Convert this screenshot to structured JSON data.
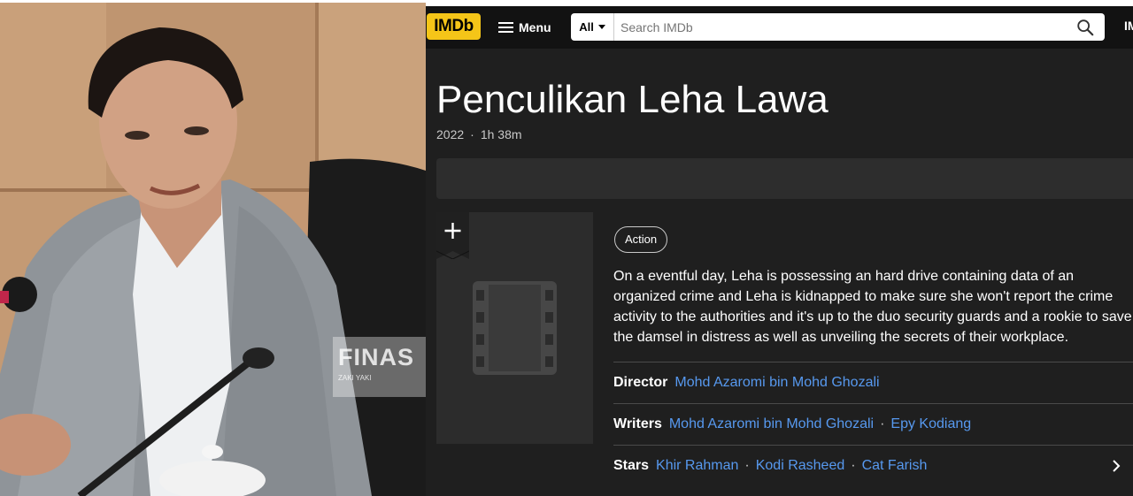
{
  "photo": {
    "watermark_main": "FINAS",
    "watermark_sub": "ZAKI YAKI"
  },
  "imdb": {
    "logo": "IMDb",
    "menu_label": "Menu",
    "search": {
      "category": "All",
      "placeholder": "Search IMDb"
    },
    "topbar_edge": "IM",
    "title": "Penculikan Leha Lawa",
    "meta": {
      "year": "2022",
      "separator": "·",
      "runtime": "1h 38m"
    },
    "genre": "Action",
    "plot": "On a eventful day, Leha is possessing an hard drive containing data of an organized crime and Leha is kidnapped to make sure she won't report the crime activity to the authorities and it's up to the duo security guards and a rookie to save the damsel in distress as well as unveiling the secrets of their workplace.",
    "director": {
      "label": "Director",
      "names": [
        "Mohd Azaromi bin Mohd Ghozali"
      ]
    },
    "writers": {
      "label": "Writers",
      "names": [
        "Mohd Azaromi bin Mohd Ghozali",
        "Epy Kodiang"
      ]
    },
    "stars": {
      "label": "Stars",
      "names": [
        "Khir Rahman",
        "Kodi Rasheed",
        "Cat Farish"
      ]
    },
    "separator": "·"
  },
  "colors": {
    "imdb_yellow": "#f5c518",
    "page_bg": "#1f1f1f",
    "topbar_bg": "#121212",
    "link_blue": "#5799ef"
  }
}
